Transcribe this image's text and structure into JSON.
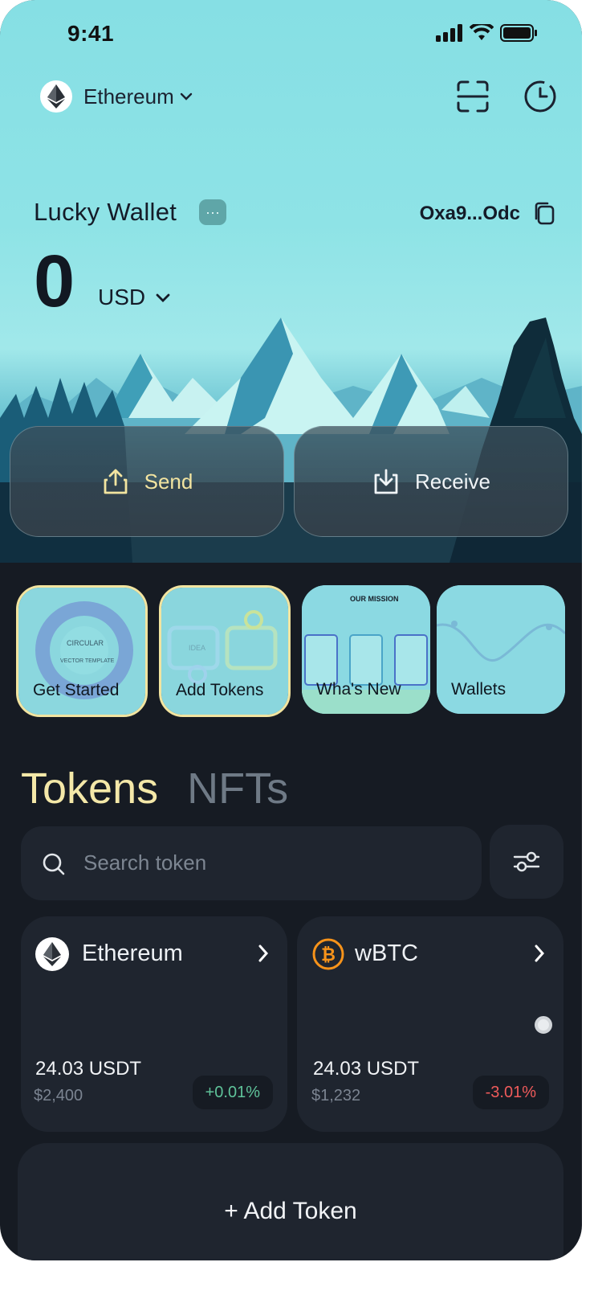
{
  "status_bar": {
    "time": "9:41"
  },
  "network": {
    "name": "Ethereum",
    "icon": "ethereum-logo-icon"
  },
  "header_actions": [
    {
      "icon": "scan-icon"
    },
    {
      "icon": "history-clock-icon"
    }
  ],
  "wallet": {
    "name": "Lucky Wallet",
    "menu_label": "···",
    "address": "Oxa9...Odc",
    "balance": "0",
    "currency": "USD"
  },
  "actions": {
    "send": "Send",
    "receive": "Receive"
  },
  "stories": [
    {
      "label": "Get Started",
      "active": true,
      "thumb_title": "CIRCULAR",
      "thumb_sub": "VECTOR TEMPLATE"
    },
    {
      "label": "Add Tokens",
      "active": true,
      "thumb_title": "IDEA"
    },
    {
      "label": "Wha's New",
      "active": false,
      "thumb_title": "OUR MISSION"
    },
    {
      "label": "Wallets",
      "active": false
    }
  ],
  "tabs": {
    "tokens": "Tokens",
    "nfts": "NFTs"
  },
  "search": {
    "placeholder": "Search token"
  },
  "tokens": [
    {
      "name": "Ethereum",
      "amount": "24.03 USDT",
      "usd": "$2,400",
      "change": "+0.01%",
      "change_color": "#5fc39a"
    },
    {
      "name": "wBTC",
      "amount": "24.03 USDT",
      "usd": "$1,232",
      "change": "-3.01%",
      "change_color": "#ef5b5b"
    }
  ],
  "add_token": {
    "label": "+ Add Token"
  },
  "colors": {
    "accent": "#f2e4a0",
    "background": "#161b23",
    "card": "#1f252f"
  }
}
